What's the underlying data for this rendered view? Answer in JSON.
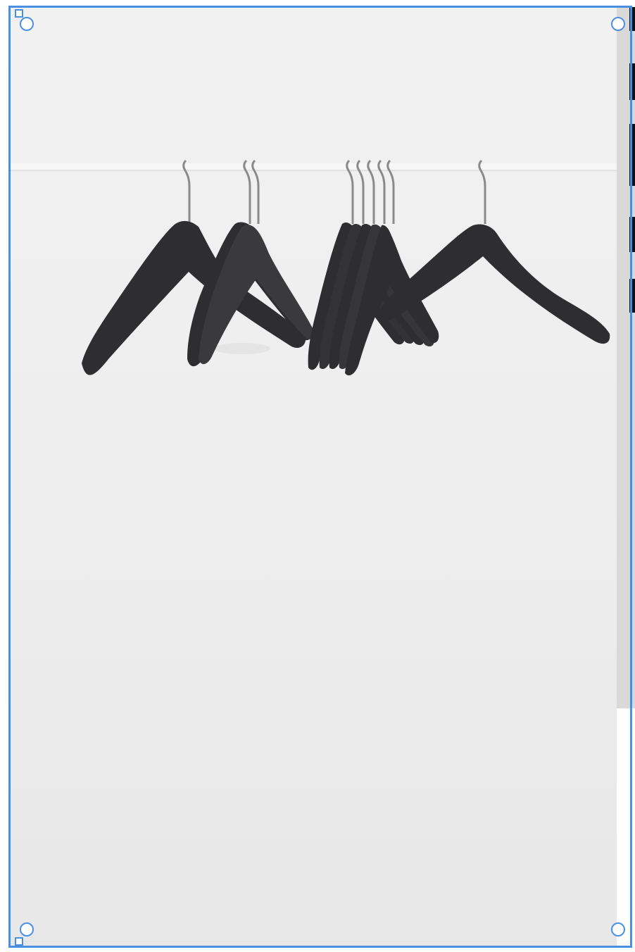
{
  "image": {
    "subject": "black-hangers-on-rail-icon"
  },
  "selection": {
    "handles": [
      "top-left",
      "top-right",
      "bottom-left",
      "bottom-right"
    ],
    "accent_color": "#4a90e2"
  },
  "colors": {
    "hanger": "#2e2e30",
    "hook": "#8a8a8a",
    "rail": "#f4f4f4",
    "wall": "#ededed",
    "panel": "#d9d9d9",
    "panel_block": "#111111"
  }
}
